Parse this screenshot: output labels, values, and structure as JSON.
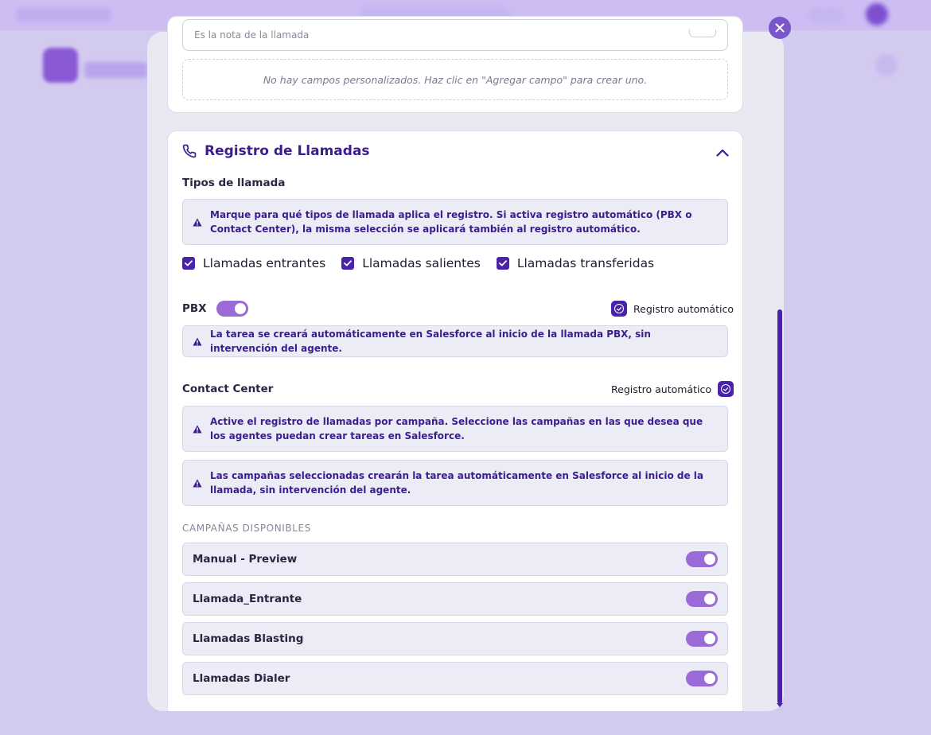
{
  "custom_fields": {
    "input_placeholder": "Es la nota de la llamada",
    "empty_message": "No hay campos personalizados. Haz clic en \"Agregar campo\" para crear uno."
  },
  "call_log": {
    "title": "Registro de Llamadas",
    "types_label": "Tipos de llamada",
    "types_notice": "Marque para qué tipos de llamada aplica el registro. Si activa registro automático (PBX o Contact Center), la misma selección se aplicará también al registro automático.",
    "types": [
      {
        "label": "Llamadas entrantes",
        "checked": true
      },
      {
        "label": "Llamadas salientes",
        "checked": true
      },
      {
        "label": "Llamadas transferidas",
        "checked": true
      }
    ],
    "pbx": {
      "label": "PBX",
      "enabled": true,
      "auto_label": "Registro automático",
      "auto_checked": true,
      "notice": "La tarea se creará automáticamente en Salesforce al inicio de la llamada PBX, sin intervención del agente."
    },
    "contact_center": {
      "label": "Contact Center",
      "auto_label": "Registro automático",
      "auto_checked": true,
      "notice1": "Active el registro de llamadas por campaña. Seleccione las campañas en las que desea que los agentes puedan crear tareas en Salesforce.",
      "notice2": "Las campañas seleccionadas crearán la tarea automáticamente en Salesforce al inicio de la llamada, sin intervención del agente."
    },
    "campaigns_heading": "CAMPAÑAS DISPONIBLES",
    "campaigns": [
      {
        "name": "Manual - Preview",
        "enabled": true
      },
      {
        "name": "Llamada_Entrante",
        "enabled": true
      },
      {
        "name": "Llamadas Blasting",
        "enabled": true
      },
      {
        "name": "Llamadas Dialer",
        "enabled": true
      }
    ]
  },
  "colors": {
    "accent": "#4a23a8",
    "toggle_on": "#9a6ad6",
    "notice_text": "#3b1d8f"
  }
}
